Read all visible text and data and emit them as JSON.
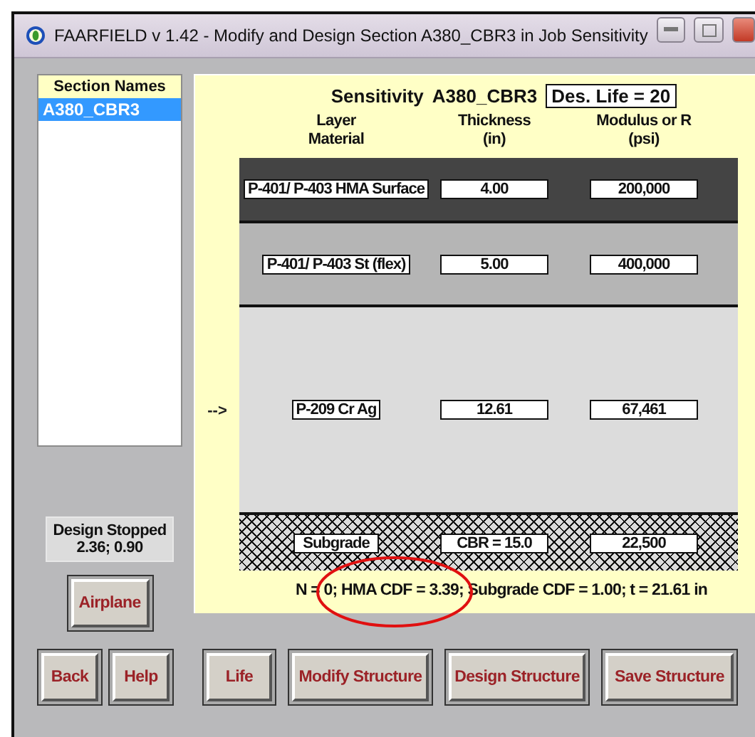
{
  "window": {
    "title": "FAARFIELD v 1.42 - Modify and Design Section A380_CBR3 in Job Sensitivity"
  },
  "sections": {
    "header": "Section Names",
    "items": [
      {
        "name": "A380_CBR3",
        "selected": true
      }
    ]
  },
  "status": {
    "title": "Design Stopped",
    "values": "2.36;  0.90"
  },
  "panel": {
    "job": "Sensitivity",
    "section": "A380_CBR3",
    "life": "Des. Life = 20",
    "columns": [
      {
        "lines": [
          "Layer",
          "Material"
        ]
      },
      {
        "lines": [
          "Thickness",
          "(in)"
        ]
      },
      {
        "lines": [
          "Modulus or R",
          "(psi)"
        ]
      }
    ],
    "layers": [
      {
        "kind": "surface",
        "material": "P-401/ P-403 HMA Surface",
        "thickness": "4.00",
        "modulus": "200,000"
      },
      {
        "kind": "base",
        "material": "P-401/ P-403 St (flex)",
        "thickness": "5.00",
        "modulus": "400,000"
      },
      {
        "kind": "subbase",
        "material": "P-209 Cr Ag",
        "thickness": "12.61",
        "modulus": "67,461",
        "marker": "-->"
      },
      {
        "kind": "subgrade",
        "material": "Subgrade",
        "thickness": "CBR = 15.0",
        "modulus": "22,500"
      }
    ],
    "summary": "N = 0; HMA CDF = 3.39; Subgrade CDF = 1.00; t = 21.61 in"
  },
  "side_button": "Airplane",
  "nav_buttons": [
    "Back",
    "Help"
  ],
  "action_buttons": [
    "Life",
    "Modify Structure",
    "Design Structure",
    "Save Structure"
  ]
}
